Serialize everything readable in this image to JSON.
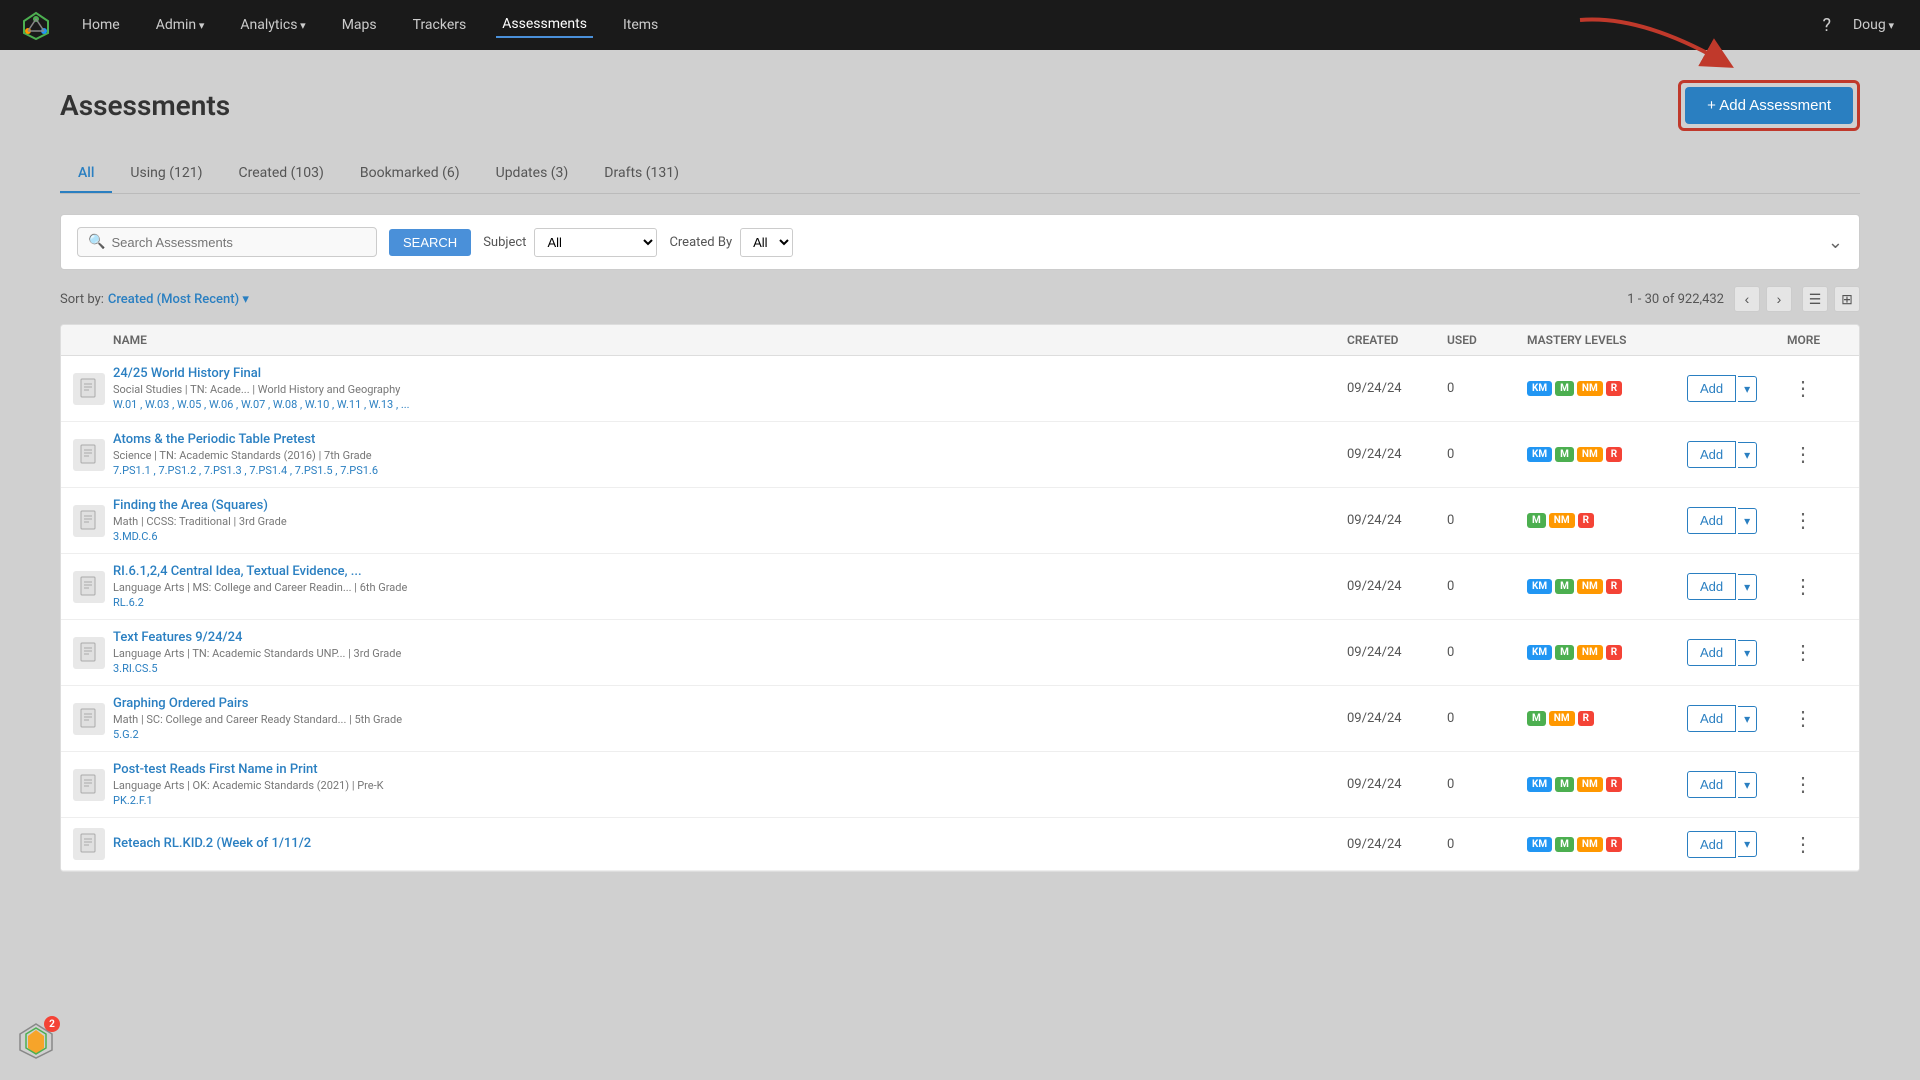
{
  "nav": {
    "home": "Home",
    "admin": "Admin",
    "analytics": "Analytics",
    "maps": "Maps",
    "trackers": "Trackers",
    "assessments": "Assessments",
    "items": "Items"
  },
  "user": {
    "name": "Doug",
    "help_icon": "?"
  },
  "page": {
    "title": "Assessments",
    "add_button": "+ Add Assessment"
  },
  "tabs": [
    {
      "label": "All",
      "active": true
    },
    {
      "label": "Using (121)",
      "active": false
    },
    {
      "label": "Created (103)",
      "active": false
    },
    {
      "label": "Bookmarked (6)",
      "active": false
    },
    {
      "label": "Updates (3)",
      "active": false
    },
    {
      "label": "Drafts (131)",
      "active": false
    }
  ],
  "search": {
    "placeholder": "Search Assessments",
    "button": "SEARCH",
    "subject_label": "Subject",
    "subject_value": "All",
    "created_by_label": "Created By",
    "created_by_value": "All"
  },
  "sort": {
    "label": "Sort by:",
    "value": "Created (Most Recent)"
  },
  "pagination": {
    "range": "1 - 30",
    "total": "922,432"
  },
  "table": {
    "headers": [
      "",
      "NAME",
      "CREATED",
      "USED",
      "MASTERY LEVELS",
      "",
      "MORE"
    ],
    "rows": [
      {
        "id": 1,
        "name": "24/25 World History Final",
        "meta": "Social Studies | TN: Acade... | World History and Geography",
        "standards": "W.01 , W.03 , W.05 , W.06 , W.07 , W.08 , W.10 , W.11 , W.13 , ...",
        "created": "09/24/24",
        "used": "0",
        "badges": [
          "KM",
          "M",
          "NM",
          "R"
        ]
      },
      {
        "id": 2,
        "name": "Atoms & the Periodic Table Pretest",
        "meta": "Science | TN: Academic Standards (2016) | 7th Grade",
        "standards": "7.PS1.1 , 7.PS1.2 , 7.PS1.3 , 7.PS1.4 , 7.PS1.5 , 7.PS1.6",
        "created": "09/24/24",
        "used": "0",
        "badges": [
          "KM",
          "M",
          "NM",
          "R"
        ]
      },
      {
        "id": 3,
        "name": "Finding the Area (Squares)",
        "meta": "Math | CCSS: Traditional | 3rd Grade",
        "standards": "3.MD.C.6",
        "created": "09/24/24",
        "used": "0",
        "badges": [
          "M",
          "NM",
          "R"
        ]
      },
      {
        "id": 4,
        "name": "RI.6.1,2,4 Central Idea, Textual Evidence, ...",
        "meta": "Language Arts | MS: College and Career Readin... | 6th Grade",
        "standards": "RL.6.2",
        "created": "09/24/24",
        "used": "0",
        "badges": [
          "KM",
          "M",
          "NM",
          "R"
        ]
      },
      {
        "id": 5,
        "name": "Text Features 9/24/24",
        "meta": "Language Arts | TN: Academic Standards UNP... | 3rd Grade",
        "standards": "3.RI.CS.5",
        "created": "09/24/24",
        "used": "0",
        "badges": [
          "KM",
          "M",
          "NM",
          "R"
        ]
      },
      {
        "id": 6,
        "name": "Graphing Ordered Pairs",
        "meta": "Math | SC: College and Career Ready Standard... | 5th Grade",
        "standards": "5.G.2",
        "created": "09/24/24",
        "used": "0",
        "badges": [
          "M",
          "NM",
          "R"
        ]
      },
      {
        "id": 7,
        "name": "Post-test Reads First Name in Print",
        "meta": "Language Arts | OK: Academic Standards (2021) | Pre-K",
        "standards": "PK.2.F.1",
        "created": "09/24/24",
        "used": "0",
        "badges": [
          "KM",
          "M",
          "NM",
          "R"
        ]
      },
      {
        "id": 8,
        "name": "Reteach RL.KID.2 (Week of 1/11/2",
        "meta": "",
        "standards": "",
        "created": "09/24/24",
        "used": "0",
        "badges": [
          "KM",
          "M",
          "NM",
          "R"
        ]
      }
    ]
  },
  "notification_count": "2",
  "add_btn_label": "Add",
  "more_icon": "⋮",
  "prev_icon": "‹",
  "next_icon": "›",
  "list_view_icon": "☰",
  "grid_view_icon": "⊞"
}
